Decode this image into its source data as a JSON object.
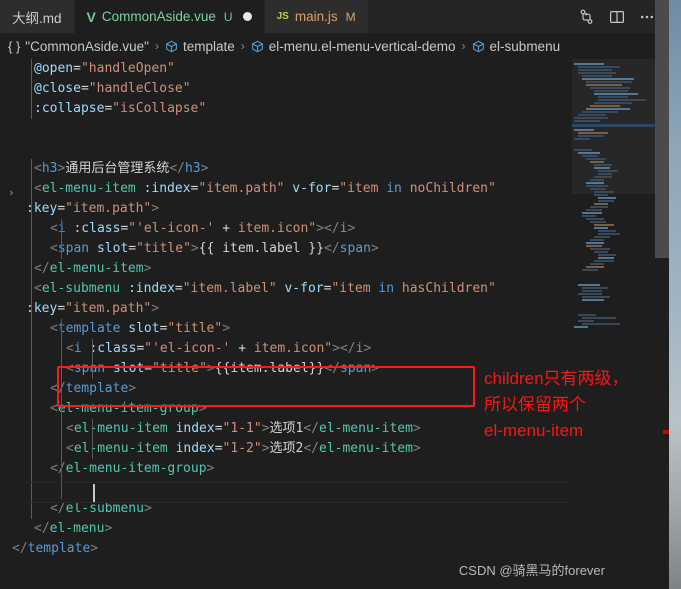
{
  "tabs": [
    {
      "label": "大纲.md",
      "icon": "markdown-icon",
      "icon_text": "",
      "badge": "",
      "modified_dot": false,
      "active": false,
      "color_class": "md"
    },
    {
      "label": "CommonAside.vue",
      "icon": "vue-icon",
      "icon_text": "V",
      "badge": "U",
      "modified_dot": true,
      "active": true,
      "color_class": "vue"
    },
    {
      "label": "main.js",
      "icon": "js-icon",
      "icon_text": "JS",
      "badge": "M",
      "modified_dot": false,
      "active": false,
      "color_class": "js"
    }
  ],
  "tab_actions": [
    {
      "name": "source-control-icon",
      "title": "Source Control"
    },
    {
      "name": "split-editor-icon",
      "title": "Split Editor"
    },
    {
      "name": "more-actions-icon",
      "title": "More Actions..."
    }
  ],
  "breadcrumb": {
    "items": [
      {
        "icon": "braces-icon",
        "text": "\"CommonAside.vue\""
      },
      {
        "icon": "cube-icon",
        "text": "template"
      },
      {
        "icon": "cube-icon",
        "text": "el-menu.el-menu-vertical-demo"
      },
      {
        "icon": "cube-icon",
        "text": "el-submenu"
      }
    ],
    "separator": "›"
  },
  "code_lines": [
    {
      "indent_guides": [
        1
      ],
      "html": "<span class=\"attr\">@open</span><span class=\"plain\">=</span><span class=\"str\">\"handleOpen\"</span>",
      "pad": 8
    },
    {
      "indent_guides": [
        1
      ],
      "html": "<span class=\"attr\">@close</span><span class=\"plain\">=</span><span class=\"str\">\"handleClose\"</span>",
      "pad": 8
    },
    {
      "indent_guides": [
        1
      ],
      "html": "<span class=\"attr\">:collapse</span><span class=\"plain\">=</span><span class=\"str\">\"isCollapse\"</span>",
      "pad": 8
    },
    {
      "indent_guides": [],
      "html": "",
      "pad": 8,
      "fold": "›"
    },
    {
      "indent_guides": [],
      "html": "",
      "pad": 8
    },
    {
      "indent_guides": [
        1
      ],
      "html": "<span class=\"punct\">&lt;</span><span class=\"tag\">h3</span><span class=\"punct\">&gt;</span><span class=\"cn\">通用后台管理系统</span><span class=\"punct\">&lt;/</span><span class=\"tag\">h3</span><span class=\"punct\">&gt;</span>",
      "pad": 8
    },
    {
      "indent_guides": [
        1
      ],
      "html": "<span class=\"punct\">&lt;</span><span class=\"tagname\">el-menu-item</span> <span class=\"attr\">:index</span><span class=\"plain\">=</span><span class=\"str\">\"item.path\"</span> <span class=\"attr\">v-for</span><span class=\"plain\">=</span><span class=\"str\">\"item </span><span class=\"kw\">in</span><span class=\"str\"> noChildren\"</span>",
      "pad": 8
    },
    {
      "indent_guides": [
        1
      ],
      "html": "<span class=\"attr\">:key</span><span class=\"plain\">=</span><span class=\"str\">\"item.path\"</span><span class=\"punct\">&gt;</span>",
      "pad": 0
    },
    {
      "indent_guides": [
        1,
        2
      ],
      "html": "<span class=\"punct\">&lt;</span><span class=\"tag\">i</span> <span class=\"attr\">:class</span><span class=\"plain\">=</span><span class=\"str\">\"'el-icon-'</span> <span class=\"plain\">+</span> <span class=\"str\">item.icon\"</span><span class=\"punct\">&gt;&lt;/</span><span class=\"tag\">i</span><span class=\"punct\">&gt;</span>",
      "pad": 24
    },
    {
      "indent_guides": [
        1,
        2
      ],
      "html": "<span class=\"punct\">&lt;</span><span class=\"tag\">span</span> <span class=\"attr\">slot</span><span class=\"plain\">=</span><span class=\"str\">\"title\"</span><span class=\"punct\">&gt;</span><span class=\"mustache\">{{ item.label }}</span><span class=\"punct\">&lt;/</span><span class=\"tag\">span</span><span class=\"punct\">&gt;</span>",
      "pad": 24
    },
    {
      "indent_guides": [
        1
      ],
      "html": "<span class=\"punct\">&lt;/</span><span class=\"tagname\">el-menu-item</span><span class=\"punct\">&gt;</span>",
      "pad": 8
    },
    {
      "indent_guides": [
        1
      ],
      "html": "<span class=\"punct\">&lt;</span><span class=\"tagname\">el-submenu</span> <span class=\"attr\">:index</span><span class=\"plain\">=</span><span class=\"str\">\"item.label\"</span> <span class=\"attr\">v-for</span><span class=\"plain\">=</span><span class=\"str\">\"item </span><span class=\"kw\">in</span><span class=\"str\"> hasChildren\"</span>",
      "pad": 8
    },
    {
      "indent_guides": [
        1
      ],
      "html": "<span class=\"attr\">:key</span><span class=\"plain\">=</span><span class=\"str\">\"item.path\"</span><span class=\"punct\">&gt;</span>",
      "pad": 0
    },
    {
      "indent_guides": [
        1,
        2
      ],
      "html": "<span class=\"punct\">&lt;</span><span class=\"tag\">template</span> <span class=\"attr\">slot</span><span class=\"plain\">=</span><span class=\"str\">\"title\"</span><span class=\"punct\">&gt;</span>",
      "pad": 24
    },
    {
      "indent_guides": [
        1,
        2,
        3
      ],
      "html": "<span class=\"punct\">&lt;</span><span class=\"tag\">i</span> <span class=\"attr\">:class</span><span class=\"plain\">=</span><span class=\"str\">\"'el-icon-'</span> <span class=\"plain\">+</span> <span class=\"str\">item.icon\"</span><span class=\"punct\">&gt;&lt;/</span><span class=\"tag\">i</span><span class=\"punct\">&gt;</span>",
      "pad": 40
    },
    {
      "indent_guides": [
        1,
        2,
        3
      ],
      "html": "<span class=\"punct\">&lt;</span><span class=\"tag\">span</span> <span class=\"attr\">slot</span><span class=\"plain\">=</span><span class=\"str\">\"title\"</span><span class=\"punct\">&gt;</span><span class=\"mustache\">{{item.label}}</span><span class=\"punct\">&lt;/</span><span class=\"tag\">span</span><span class=\"punct\">&gt;</span>",
      "pad": 40
    },
    {
      "indent_guides": [
        1,
        2
      ],
      "html": "<span class=\"punct\">&lt;/</span><span class=\"tag\">template</span><span class=\"punct\">&gt;</span>",
      "pad": 24
    },
    {
      "indent_guides": [
        1,
        2
      ],
      "html": "<span class=\"punct\">&lt;</span><span class=\"tagname\">el-menu-item-group</span><span class=\"punct\">&gt;</span>",
      "pad": 24
    },
    {
      "indent_guides": [
        1,
        2,
        3
      ],
      "html": "<span class=\"punct\">&lt;</span><span class=\"tagname\">el-menu-item</span> <span class=\"attr\">index</span><span class=\"plain\">=</span><span class=\"str\">\"1-1\"</span><span class=\"punct\">&gt;</span><span class=\"cn\">选项1</span><span class=\"punct\">&lt;/</span><span class=\"tagname\">el-menu-item</span><span class=\"punct\">&gt;</span>",
      "pad": 40
    },
    {
      "indent_guides": [
        1,
        2,
        3
      ],
      "html": "<span class=\"punct\">&lt;</span><span class=\"tagname\">el-menu-item</span> <span class=\"attr\">index</span><span class=\"plain\">=</span><span class=\"str\">\"1-2\"</span><span class=\"punct\">&gt;</span><span class=\"cn\">选项2</span><span class=\"punct\">&lt;/</span><span class=\"tagname\">el-menu-item</span><span class=\"punct\">&gt;</span>",
      "pad": 40
    },
    {
      "indent_guides": [
        1,
        2
      ],
      "html": "<span class=\"punct\">&lt;/</span><span class=\"tagname\">el-menu-item-group</span><span class=\"punct\">&gt;</span>",
      "pad": 24
    },
    {
      "indent_guides": [
        1,
        2
      ],
      "html": "",
      "pad": 24
    },
    {
      "indent_guides": [
        1
      ],
      "html": "<span class=\"punct\">&lt;/</span><span class=\"tagname\">el-submenu</span><span class=\"punct\">&gt;</span>",
      "pad": 24
    },
    {
      "indent_guides": [],
      "html": "<span class=\"punct\">&lt;/</span><span class=\"tagname\">el-menu</span><span class=\"punct\">&gt;</span>",
      "pad": 8
    },
    {
      "indent_guides": [],
      "html": "<span class=\"punct\">&lt;/</span><span class=\"tag\">template</span><span class=\"punct\">&gt;</span>",
      "pad": -14
    }
  ],
  "annotation": {
    "line1": "children只有两级，",
    "line2": "所以保留两个",
    "line3": "el-menu-item",
    "color": "#ff1414"
  },
  "highlight_box": {
    "color": "#ff1a1a"
  },
  "watermark": {
    "text": "CSDN @骑黑马的forever"
  },
  "colors": {
    "editor_bg": "#1e1e1e",
    "tabbar_bg": "#252526",
    "inactive_tab_bg": "#2d2d2d",
    "tag": "#569cd6",
    "tagname": "#4ec9b0",
    "attribute": "#9cdcfe",
    "string": "#ce9178",
    "annotation_red": "#ff1414"
  }
}
